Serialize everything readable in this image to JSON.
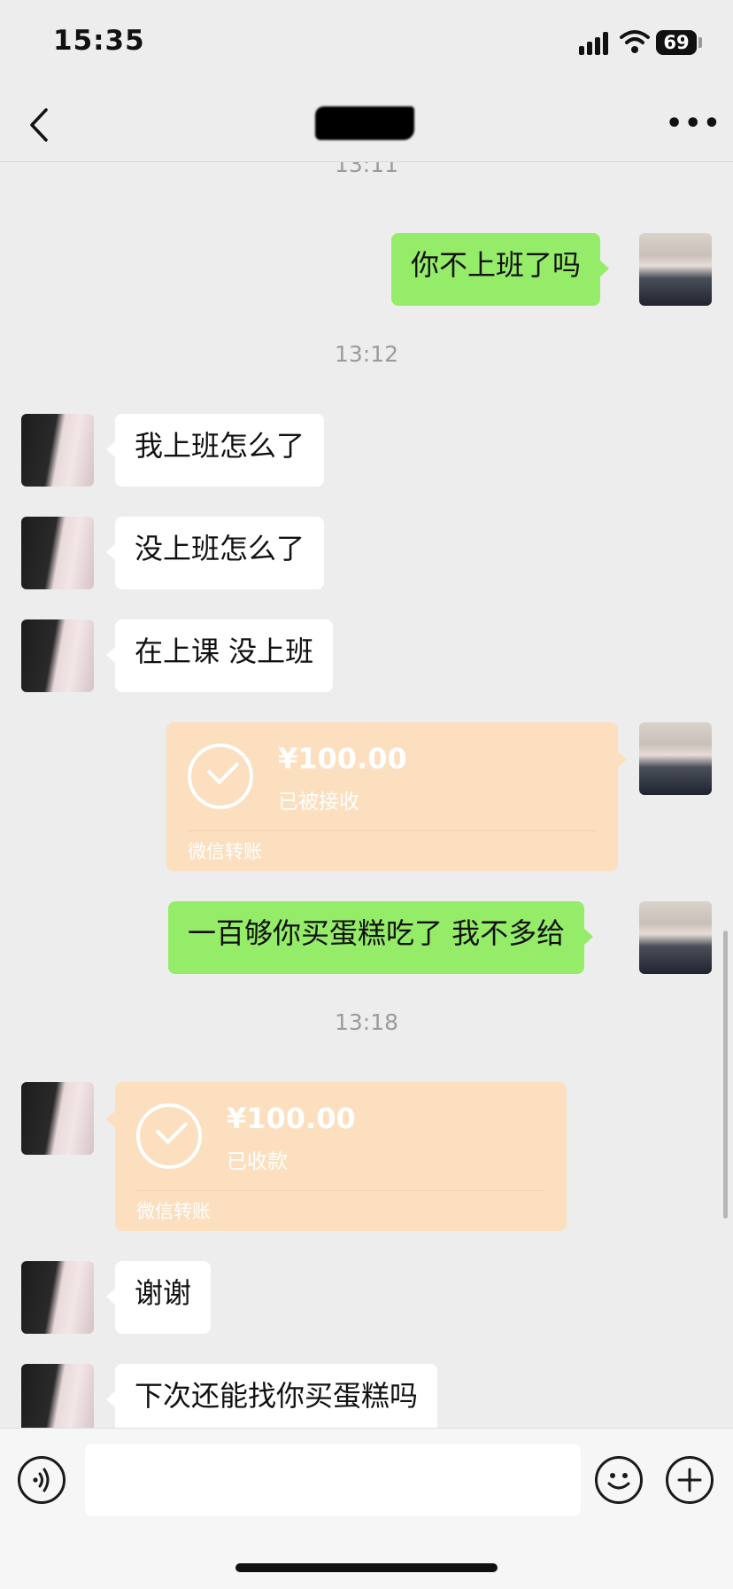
{
  "status_bar": {
    "time": "15:35",
    "battery": "69"
  },
  "nav": {
    "back_icon": "chevron-left-icon",
    "more_icon": "ellipsis-icon",
    "more_label": "•••"
  },
  "messages": [
    {
      "type": "timestamp",
      "text": "13:11"
    },
    {
      "type": "text",
      "side": "right",
      "text": "你不上班了吗"
    },
    {
      "type": "timestamp",
      "text": "13:12"
    },
    {
      "type": "text",
      "side": "left",
      "text": "我上班怎么了"
    },
    {
      "type": "text",
      "side": "left",
      "text": "没上班怎么了"
    },
    {
      "type": "text",
      "side": "left",
      "text": "在上课 没上班"
    },
    {
      "type": "transfer",
      "side": "right",
      "amount": "¥100.00",
      "status": "已被接收",
      "source": "微信转账"
    },
    {
      "type": "text",
      "side": "right",
      "text": "一百够你买蛋糕吃了 我不多给"
    },
    {
      "type": "timestamp",
      "text": "13:18"
    },
    {
      "type": "transfer",
      "side": "left",
      "amount": "¥100.00",
      "status": "已收款",
      "source": "微信转账"
    },
    {
      "type": "text",
      "side": "left",
      "text": "谢谢"
    },
    {
      "type": "text",
      "side": "left",
      "text": "下次还能找你买蛋糕吗"
    }
  ],
  "input_bar": {
    "voice_icon": "voice-icon",
    "emoji_icon": "emoji-icon",
    "plus_icon": "plus-icon",
    "input_value": ""
  },
  "colors": {
    "background": "#ededed",
    "sent_bubble": "#95ec69",
    "received_bubble": "#ffffff",
    "transfer_card": "#fbdfbf"
  }
}
